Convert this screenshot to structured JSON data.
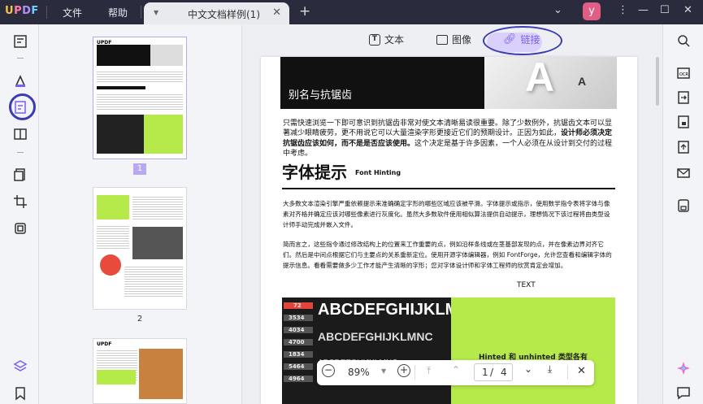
{
  "app": {
    "logo": "UPDF",
    "menu_file": "文件",
    "menu_help": "帮助"
  },
  "tab": {
    "title": "中文文档样例(1)"
  },
  "user": {
    "avatar_letter": "y"
  },
  "toolbar": {
    "text_label": "文本",
    "image_label": "图像",
    "link_label": "链接"
  },
  "thumbnails": [
    {
      "page": "1"
    },
    {
      "page": "2"
    }
  ],
  "document": {
    "banner_subtitle": "别名与抗锯齿",
    "banner_logo": "A",
    "para1_a": "只需快速浏览一下即可意识到抗锯齿非常对使文本清晰易读很重要。除了少数例外，抗锯齿文本可以显著减少眼睛疲劳，更不用说它可以大量渲染字形更接近它们的预期设计。正因为如此，",
    "para1_bold": "设计师必须决定抗锯齿应该如何，而不是是否应该使用。",
    "para1_b": "这个决定是基于许多因素，一个人必须在从设计到交付的过程中考虑。",
    "heading": "字体提示",
    "heading_en": "Font Hinting",
    "para2": "大多数文本渲染引擎严重依赖提示来准确确定字形的哪些区域应该被平滑。字体提示或指示，使用数学指令表将字体与像素对齐格并确定应该对哪些像素进行灰度化。虽然大多数软件使用相似算法提供自动提示，理想情况下该过程将由类型设计师手动完成并嵌入文件。",
    "para3": "简而言之，这些指令通过修改结构上的位置来工作重要的点，例如沿样条线或在茎基部发现的点，并在像素边界对齐它们。然后是中间点根据它们与主要点的关系重新定位。使用开源字体编辑器，例如 FontForge，允许您查看和编辑字体的提示信息。看看需要做多少工作才能产生清晰的字形；您对字体设计师和字体工程师的欣赏肯定会增加。",
    "text_caption": "TEXT",
    "img_text": "ABCDEFGHIJKLMNC",
    "img_row1": "ABCDEFGHIJKLMNC",
    "img_nums": [
      "72",
      "3534",
      "4034",
      "4700",
      "1834",
      "5464",
      "4964"
    ],
    "green_text": "Hinted 和 unhinted 类型各有"
  },
  "zoom": {
    "level": "89%",
    "current_page": "1",
    "total_pages": "4",
    "page_sep": "/"
  },
  "colors": {
    "accent": "#7a5ff0",
    "highlight_ring": "#3b3bb3",
    "lime": "#b5ea4a",
    "titlebar": "#2a2b3d"
  }
}
